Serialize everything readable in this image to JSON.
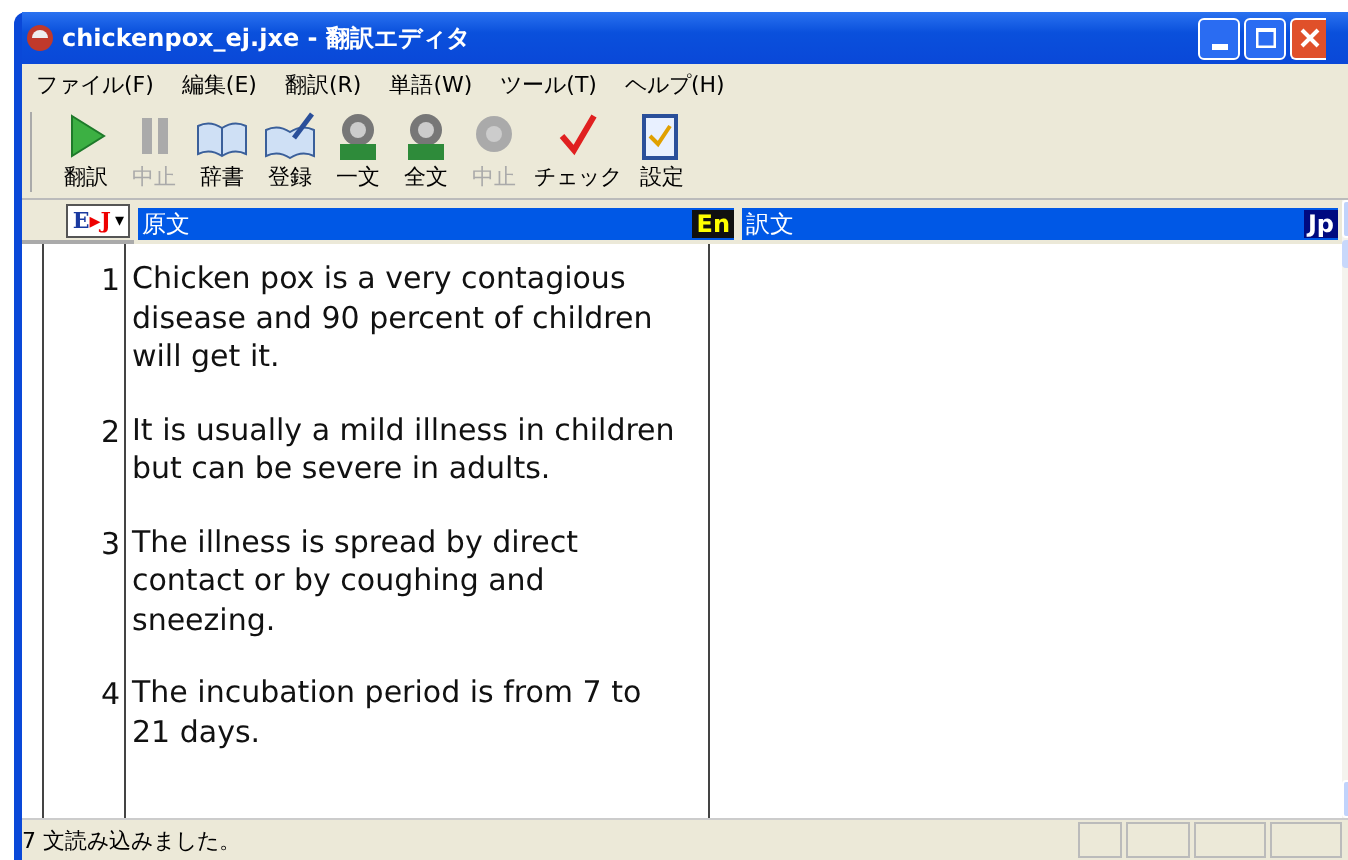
{
  "window": {
    "title": "chickenpox_ej.jxe - 翻訳エディタ"
  },
  "menu": [
    "ファイル(F)",
    "編集(E)",
    "翻訳(R)",
    "単語(W)",
    "ツール(T)",
    "ヘルプ(H)"
  ],
  "toolbar": [
    {
      "kind": "play",
      "label": "翻訳",
      "disabled": false
    },
    {
      "kind": "pause",
      "label": "中止",
      "disabled": true
    },
    {
      "kind": "book",
      "label": "辞書",
      "disabled": false
    },
    {
      "kind": "register",
      "label": "登録",
      "disabled": false
    },
    {
      "kind": "speaker-one",
      "label": "一文",
      "disabled": false
    },
    {
      "kind": "speaker-all",
      "label": "全文",
      "disabled": false
    },
    {
      "kind": "speaker-stop",
      "label": "中止",
      "disabled": true
    },
    {
      "kind": "check",
      "label": "チェック",
      "disabled": false
    },
    {
      "kind": "settings",
      "label": "設定",
      "disabled": false
    }
  ],
  "direction": {
    "source": "E",
    "arrow": "▸",
    "target": "J",
    "caret": "▾"
  },
  "columns": [
    {
      "title": "原文",
      "badge": "En"
    },
    {
      "title": "訳文",
      "badge": "Jp"
    }
  ],
  "rows": [
    {
      "number": "1",
      "source": "Chicken pox is a very contagious disease and 90 percent of children will get it."
    },
    {
      "number": "2",
      "source": "It is usually a mild illness in children but can be severe in adults."
    },
    {
      "number": "3",
      "source": "The illness is spread by direct contact or by coughing and sneezing."
    },
    {
      "number": "4",
      "source": "The incubation period is from 7 to 21 days."
    }
  ],
  "status_bar": {
    "text": "7 文読み込みました。"
  }
}
